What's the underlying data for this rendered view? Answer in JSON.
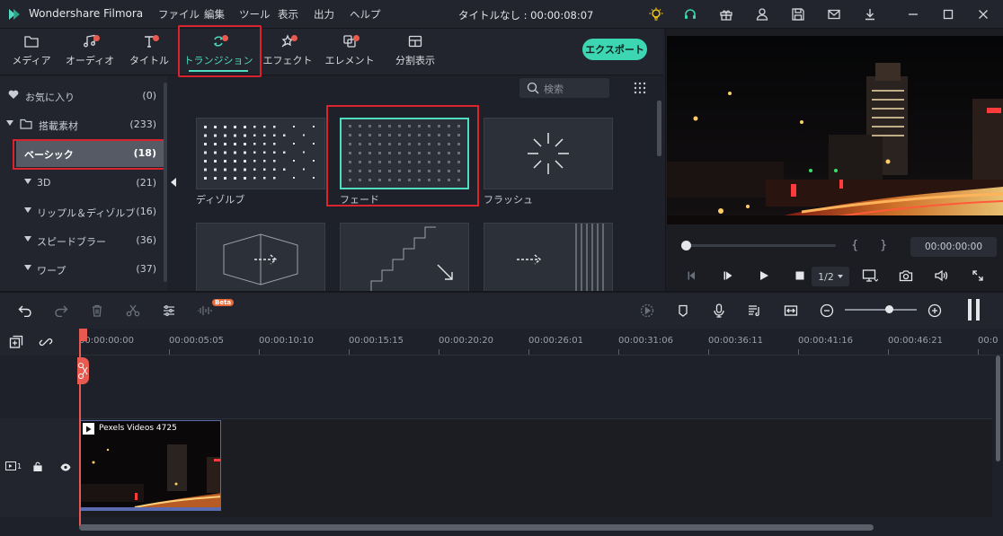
{
  "titlebar": {
    "app_name": "Wondershare Filmora",
    "menu": [
      "ファイル",
      "編集",
      "ツール",
      "表示",
      "出力",
      "ヘルプ"
    ],
    "window_title": "タイトルなし : 00:00:08:07",
    "icons": [
      "bulb-icon",
      "headset-icon",
      "gift-icon",
      "user-icon",
      "save-icon",
      "mail-icon",
      "download-icon",
      "minimize-icon",
      "maximize-icon",
      "close-icon"
    ]
  },
  "tabs": [
    {
      "label": "メディア",
      "icon": "folder-icon",
      "dot": false
    },
    {
      "label": "オーディオ",
      "icon": "music-icon",
      "dot": true
    },
    {
      "label": "タイトル",
      "icon": "text-icon",
      "dot": true
    },
    {
      "label": "トランジション",
      "icon": "transition-icon",
      "dot": true,
      "active": true
    },
    {
      "label": "エフェクト",
      "icon": "effect-icon",
      "dot": true
    },
    {
      "label": "エレメント",
      "icon": "element-icon",
      "dot": true
    },
    {
      "label": "分割表示",
      "icon": "split-icon",
      "dot": false
    }
  ],
  "export_label": "エクスポート",
  "sidebar": {
    "items": [
      {
        "label": "お気に入り",
        "count": "(0)"
      },
      {
        "label": "搭載素材",
        "count": "(233)"
      },
      {
        "label": "ベーシック",
        "count": "(18)",
        "selected": true
      },
      {
        "label": "3D",
        "count": "(21)"
      },
      {
        "label": "リップル＆ディゾルブ",
        "count": "(16)"
      },
      {
        "label": "スピードブラー",
        "count": "(36)"
      },
      {
        "label": "ワープ",
        "count": "(37)"
      }
    ]
  },
  "search": {
    "placeholder": "検索"
  },
  "transitions": [
    {
      "label": "ディゾルブ"
    },
    {
      "label": "フェード",
      "selected": true
    },
    {
      "label": "フラッシュ"
    },
    {
      "label": ""
    },
    {
      "label": ""
    },
    {
      "label": ""
    }
  ],
  "preview": {
    "timecode": "00:00:00:00",
    "ratio": "1/2",
    "brace_open": "{",
    "brace_close": "}"
  },
  "timeline": {
    "beta": "Beta",
    "ruler": [
      "00:00:00:00",
      "00:00:05:05",
      "00:00:10:10",
      "00:00:15:15",
      "00:00:20:20",
      "00:00:26:01",
      "00:00:31:06",
      "00:00:36:11",
      "00:00:41:16",
      "00:00:46:21",
      "00:0"
    ],
    "track_index": "1",
    "clip_title": "Pexels Videos 4725"
  },
  "colors": {
    "accent": "#4fdcc0",
    "export": "#3dd6b2",
    "highlight": "#d9232d",
    "playhead": "#e85a4f"
  }
}
